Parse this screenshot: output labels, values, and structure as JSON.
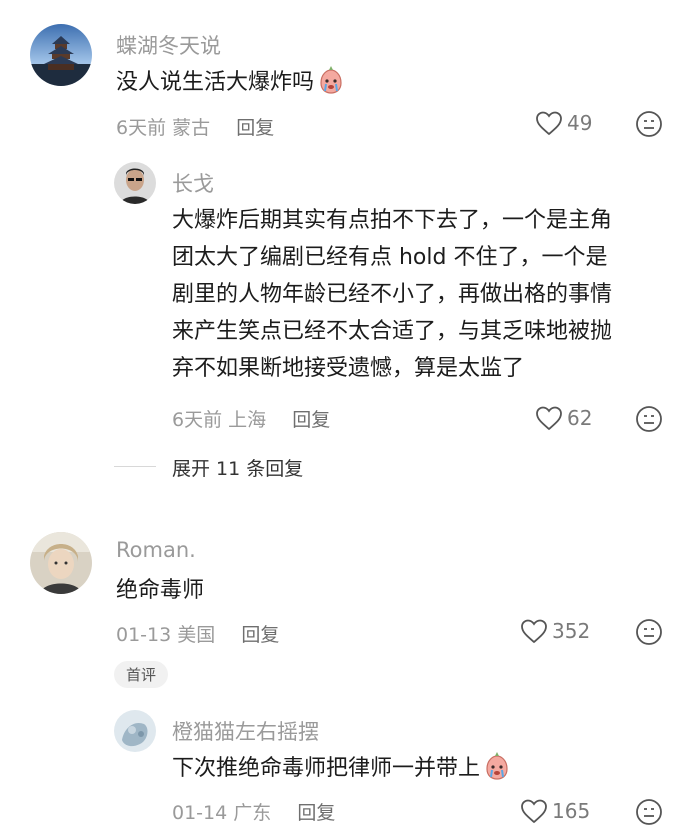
{
  "comments": [
    {
      "username": "蝶湖冬天说",
      "text": "没人说生活大爆炸吗",
      "emoji": "crying-face-sticker",
      "time": "6天前",
      "location": "蒙古",
      "reply_label": "回复",
      "likes": "49",
      "replies": [
        {
          "username": "长戈",
          "text_lines": [
            "大爆炸后期其实有点拍不下去了，一个是主角",
            "团太大了编剧已经有点 hold 不住了，一个是",
            "剧里的人物年龄已经不小了，再做出格的事情",
            "来产生笑点已经不太合适了，与其乏味地被抛",
            "弃不如果断地接受遗憾，算是太监了"
          ],
          "time": "6天前",
          "location": "上海",
          "reply_label": "回复",
          "likes": "62"
        }
      ],
      "expand_label": "展开 11 条回复"
    },
    {
      "username": "Roman.",
      "text": "绝命毒师",
      "time": "01-13",
      "location": "美国",
      "reply_label": "回复",
      "likes": "352",
      "badge": "首评",
      "replies": [
        {
          "username": "橙猫猫左右摇摆",
          "text": "下次推绝命毒师把律师一并带上",
          "emoji": "crying-face-sticker",
          "time": "01-14",
          "location": "广东",
          "reply_label": "回复",
          "likes": "165"
        }
      ]
    }
  ],
  "colors": {
    "name_gray": "#9a9a9a",
    "text_dark": "#1c1c1c",
    "emoji_pink": "#f4a9a0"
  }
}
